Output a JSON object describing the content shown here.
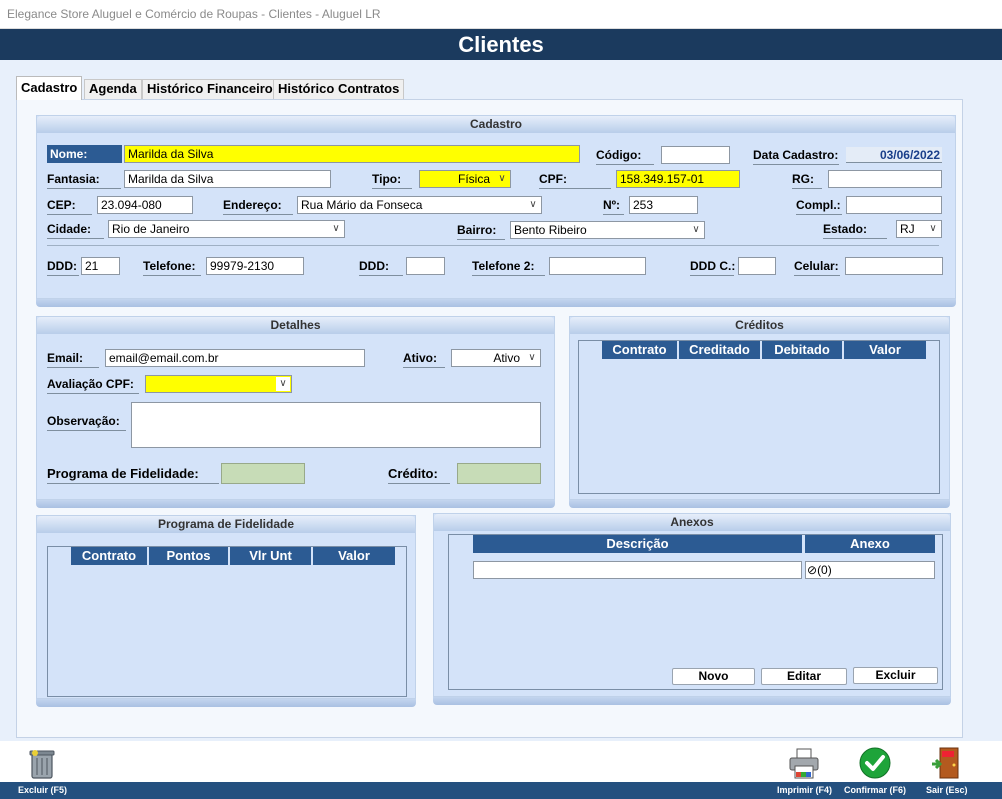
{
  "window": {
    "title": "Elegance Store Aluguel e Comércio de Roupas - Clientes - Aluguel LR"
  },
  "header": {
    "title": "Clientes"
  },
  "tabs": [
    {
      "label": "Cadastro",
      "active": true
    },
    {
      "label": "Agenda"
    },
    {
      "label": "Histórico Financeiro"
    },
    {
      "label": "Histórico Contratos"
    }
  ],
  "cadastro": {
    "title": "Cadastro",
    "nome": {
      "label": "Nome:",
      "value": "Marilda da Silva"
    },
    "codigo": {
      "label": "Código:",
      "value": ""
    },
    "data_cadastro": {
      "label": "Data Cadastro:",
      "value": "03/06/2022"
    },
    "fantasia": {
      "label": "Fantasia:",
      "value": "Marilda da Silva"
    },
    "tipo": {
      "label": "Tipo:",
      "value": "Física"
    },
    "cpf": {
      "label": "CPF:",
      "value": "158.349.157-01"
    },
    "rg": {
      "label": "RG:",
      "value": ""
    },
    "cep": {
      "label": "CEP:",
      "value": "23.094-080"
    },
    "endereco": {
      "label": "Endereço:",
      "value": "Rua Mário da Fonseca"
    },
    "numero": {
      "label": "Nº:",
      "value": "253"
    },
    "compl": {
      "label": "Compl.:",
      "value": ""
    },
    "cidade": {
      "label": "Cidade:",
      "value": "Rio de Janeiro"
    },
    "bairro": {
      "label": "Bairro:",
      "value": "Bento Ribeiro"
    },
    "estado": {
      "label": "Estado:",
      "value": "RJ"
    },
    "ddd": {
      "label": "DDD:",
      "value": "21"
    },
    "telefone": {
      "label": "Telefone:",
      "value": "99979-2130"
    },
    "ddd2": {
      "label": "DDD:",
      "value": ""
    },
    "telefone2": {
      "label": "Telefone 2:",
      "value": ""
    },
    "ddd_c": {
      "label": "DDD C.:",
      "value": ""
    },
    "celular": {
      "label": "Celular:",
      "value": ""
    }
  },
  "detalhes": {
    "title": "Detalhes",
    "email": {
      "label": "Email:",
      "value": "email@email.com.br"
    },
    "ativo": {
      "label": "Ativo:",
      "value": "Ativo"
    },
    "avaliacao_cpf": {
      "label": "Avaliação CPF:",
      "value": ""
    },
    "observacao": {
      "label": "Observação:",
      "value": ""
    },
    "programa_fidelidade": {
      "label": "Programa de Fidelidade:",
      "value": ""
    },
    "credito": {
      "label": "Crédito:",
      "value": ""
    }
  },
  "creditos": {
    "title": "Créditos",
    "columns": [
      "Contrato",
      "Creditado",
      "Debitado",
      "Valor"
    ]
  },
  "programa_fidelidade": {
    "title": "Programa de Fidelidade",
    "columns": [
      "Contrato",
      "Pontos",
      "Vlr Unt",
      "Valor"
    ]
  },
  "anexos": {
    "title": "Anexos",
    "columns": [
      "Descrição",
      "Anexo"
    ],
    "rows": [
      {
        "descricao": "",
        "anexo": "(0)"
      }
    ],
    "buttons": {
      "novo": "Novo",
      "editar": "Editar",
      "excluir": "Excluir"
    }
  },
  "toolbar": {
    "excluir": "Excluir (F5)",
    "imprimir": "Imprimir (F4)",
    "confirmar": "Confirmar (F6)",
    "sair": "Sair (Esc)"
  },
  "colors": {
    "header": "#1b3a5e",
    "grid_header": "#2c5b93",
    "highlight": "#ffff00",
    "panel": "#d4e3f9"
  },
  "icons": [
    "trash-icon",
    "printer-icon",
    "confirm-check-icon",
    "exit-door-icon",
    "paperclip-icon",
    "chevron-down-icon"
  ]
}
